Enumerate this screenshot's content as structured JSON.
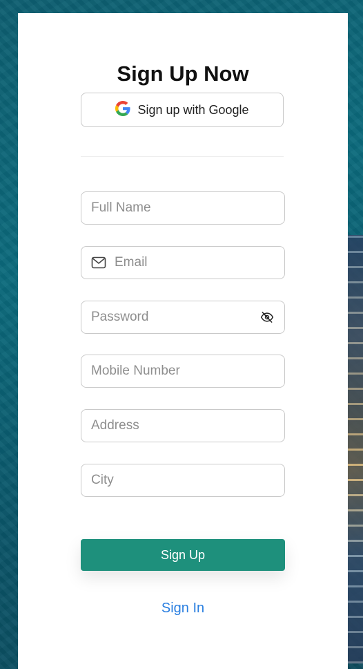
{
  "form": {
    "title": "Sign Up Now",
    "google_button_label": "Sign up with Google",
    "fields": {
      "full_name": {
        "placeholder": "Full Name"
      },
      "email": {
        "placeholder": "Email"
      },
      "password": {
        "placeholder": "Password"
      },
      "mobile": {
        "placeholder": "Mobile Number"
      },
      "address": {
        "placeholder": "Address"
      },
      "city": {
        "placeholder": "City"
      }
    },
    "submit_label": "Sign Up",
    "signin_link_label": "Sign In"
  },
  "icons": {
    "google": "google-icon",
    "email": "mail-icon",
    "password_toggle": "eye-off-icon"
  },
  "colors": {
    "primary": "#1e907c",
    "link": "#2a7fe0",
    "background": "#0b6a7c"
  }
}
